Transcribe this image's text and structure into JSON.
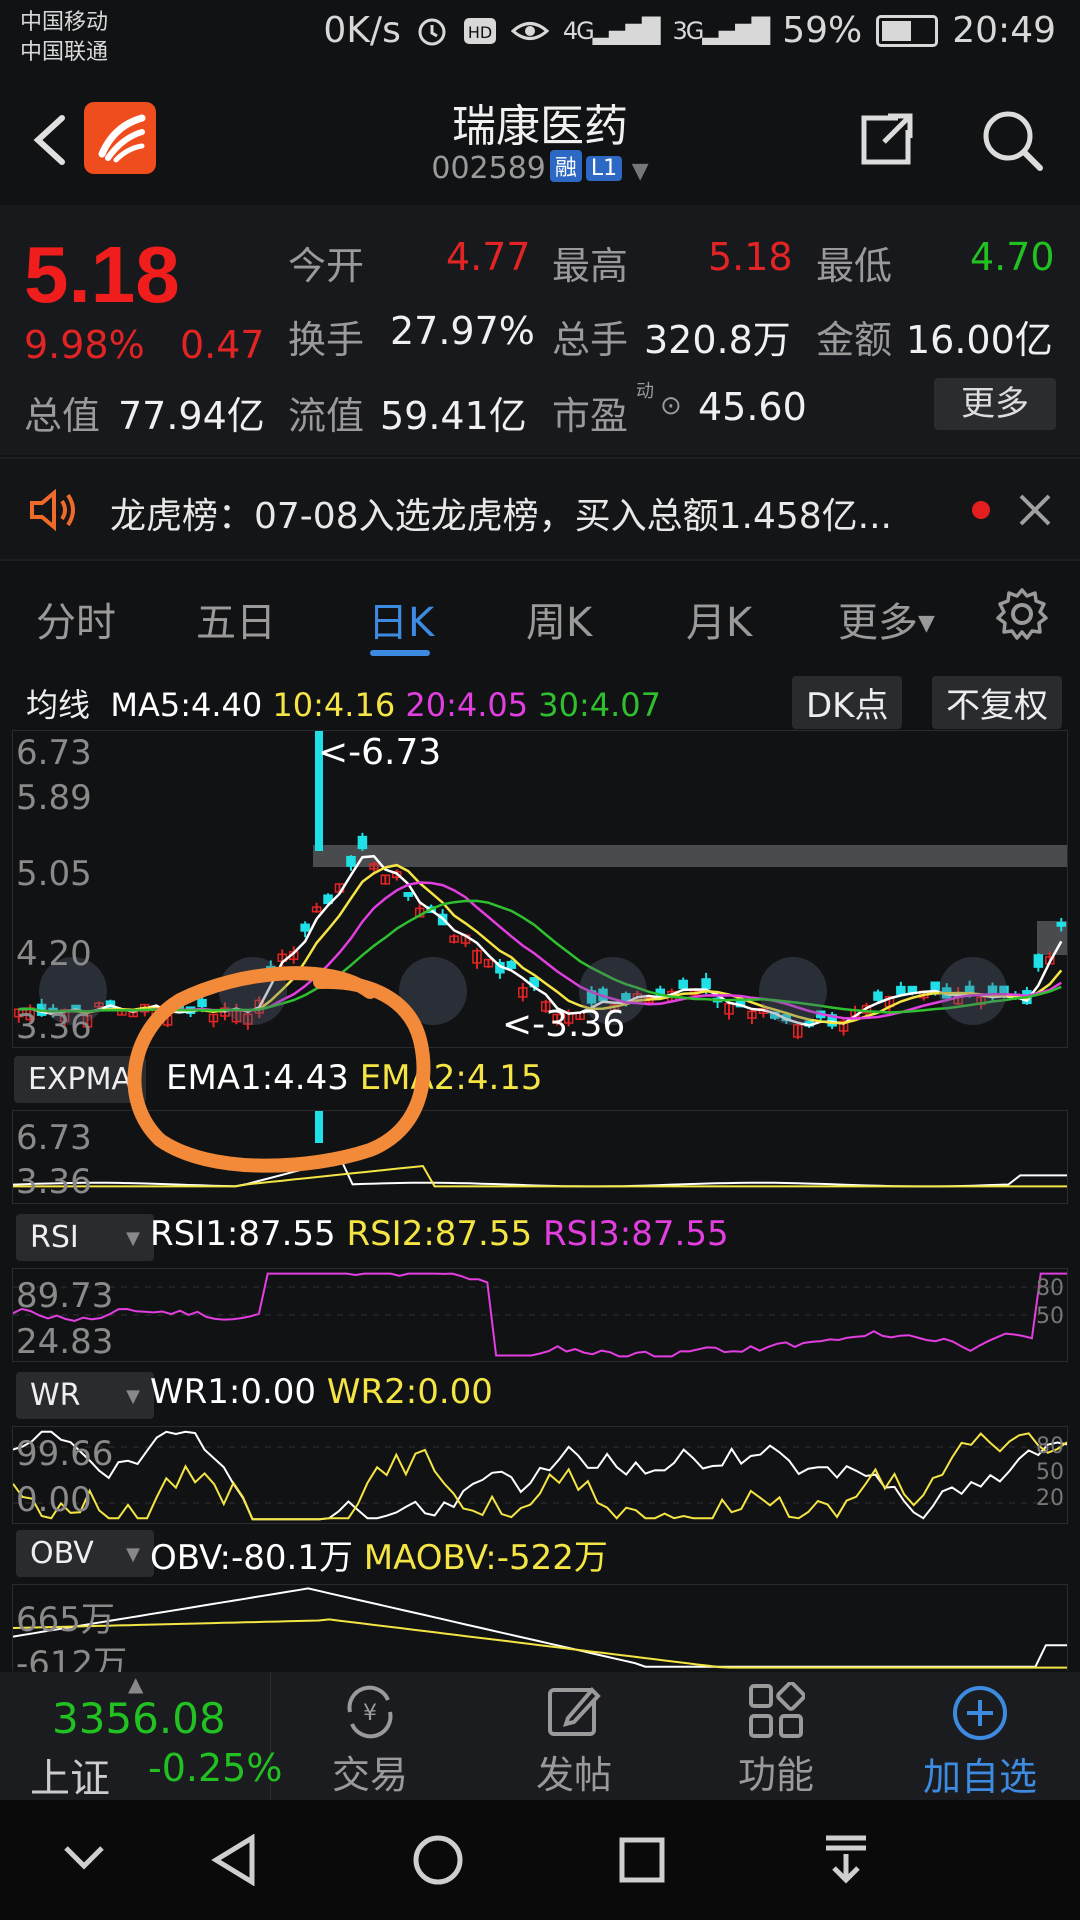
{
  "status_bar": {
    "carrier1": "中国移动",
    "carrier2": "中国联通",
    "speed": "0K/s",
    "network1": "4G",
    "network2": "3G",
    "battery": "59%",
    "time": "20:49"
  },
  "header": {
    "title": "瑞康医药",
    "code": "002589",
    "tag1": "融",
    "tag2": "L1"
  },
  "quote": {
    "price": "5.18",
    "change_pct": "9.98%",
    "change_amt": "0.47",
    "open_label": "今开",
    "open": "4.77",
    "high_label": "最高",
    "high": "5.18",
    "low_label": "最低",
    "low": "4.70",
    "turnover_label": "换手",
    "turnover": "27.97%",
    "volume_label": "总手",
    "volume": "320.8万",
    "amount_label": "金额",
    "amount": "16.00亿",
    "mcap_label": "总值",
    "mcap": "77.94亿",
    "float_label": "流值",
    "float": "59.41亿",
    "pe_label": "市盈",
    "pe_sup": "动",
    "pe": "45.60",
    "more": "更多"
  },
  "notice": {
    "text": "龙虎榜：07-08入选龙虎榜，买入总额1.458亿..."
  },
  "tabs": [
    "分时",
    "五日",
    "日K",
    "周K",
    "月K",
    "更多"
  ],
  "ma": {
    "label": "均线",
    "ma5": "MA5:4.40",
    "ma10": "10:4.16",
    "ma20": "20:4.05",
    "ma30": "30:4.07",
    "dk_btn": "DK点",
    "adj_btn": "不复权"
  },
  "kline": {
    "axis": [
      "6.73",
      "5.89",
      "5.05",
      "4.20",
      "3.36"
    ],
    "high_mark": "<-6.73",
    "low_mark": "<-3.36"
  },
  "expma": {
    "tag": "EXPMA",
    "ema1": "EMA1:4.43",
    "ema2": "EMA2:4.15",
    "axis": [
      "6.73",
      "3.36"
    ]
  },
  "rsi": {
    "tag": "RSI",
    "rsi1": "RSI1:87.55",
    "rsi2": "RSI2:87.55",
    "rsi3": "RSI3:87.55",
    "axis": [
      "89.73",
      "24.83"
    ],
    "right_axis": [
      "80",
      "50"
    ]
  },
  "wr": {
    "tag": "WR",
    "wr1": "WR1:0.00",
    "wr2": "WR2:0.00",
    "axis": [
      "99.66",
      "0.00"
    ],
    "right_axis": [
      "80",
      "50",
      "20"
    ]
  },
  "obv": {
    "tag": "OBV",
    "obv": "OBV:-80.1万",
    "maobv": "MAOBV:-522万",
    "axis": [
      "665万",
      "-612万"
    ]
  },
  "bottom": {
    "index_value": "3356.08",
    "index_name": "上证",
    "index_change": "-0.25%",
    "trade": "交易",
    "post": "发帖",
    "function": "功能",
    "add": "加自选"
  },
  "colors": {
    "up": "#e22424",
    "down": "#1fe0e6",
    "ma5": "#ffffff",
    "ma10": "#f4e444",
    "ma20": "#e23ee0",
    "ma30": "#2fbf2f",
    "accent": "#3d8be0"
  }
}
